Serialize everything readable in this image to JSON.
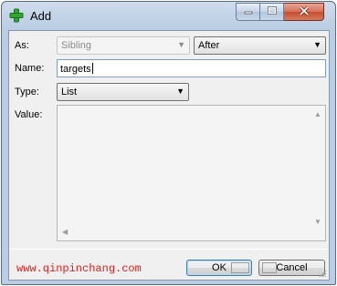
{
  "window": {
    "title": "Add"
  },
  "form": {
    "as_label": "As:",
    "as_value": "Sibling",
    "position_value": "After",
    "name_label": "Name:",
    "name_value": "targets",
    "type_label": "Type:",
    "type_value": "List",
    "value_label": "Value:"
  },
  "footer": {
    "watermark": "www.qinpinchang.com",
    "ok_label": "OK",
    "cancel_label": "Cancel"
  },
  "icons": {
    "title": "plus-icon",
    "minimize": "minimize-icon",
    "maximize": "maximize-icon",
    "close": "close-icon"
  },
  "colors": {
    "title_icon": "#2fa82f",
    "watermark": "#e0201a",
    "close_button": "#c74b30"
  }
}
